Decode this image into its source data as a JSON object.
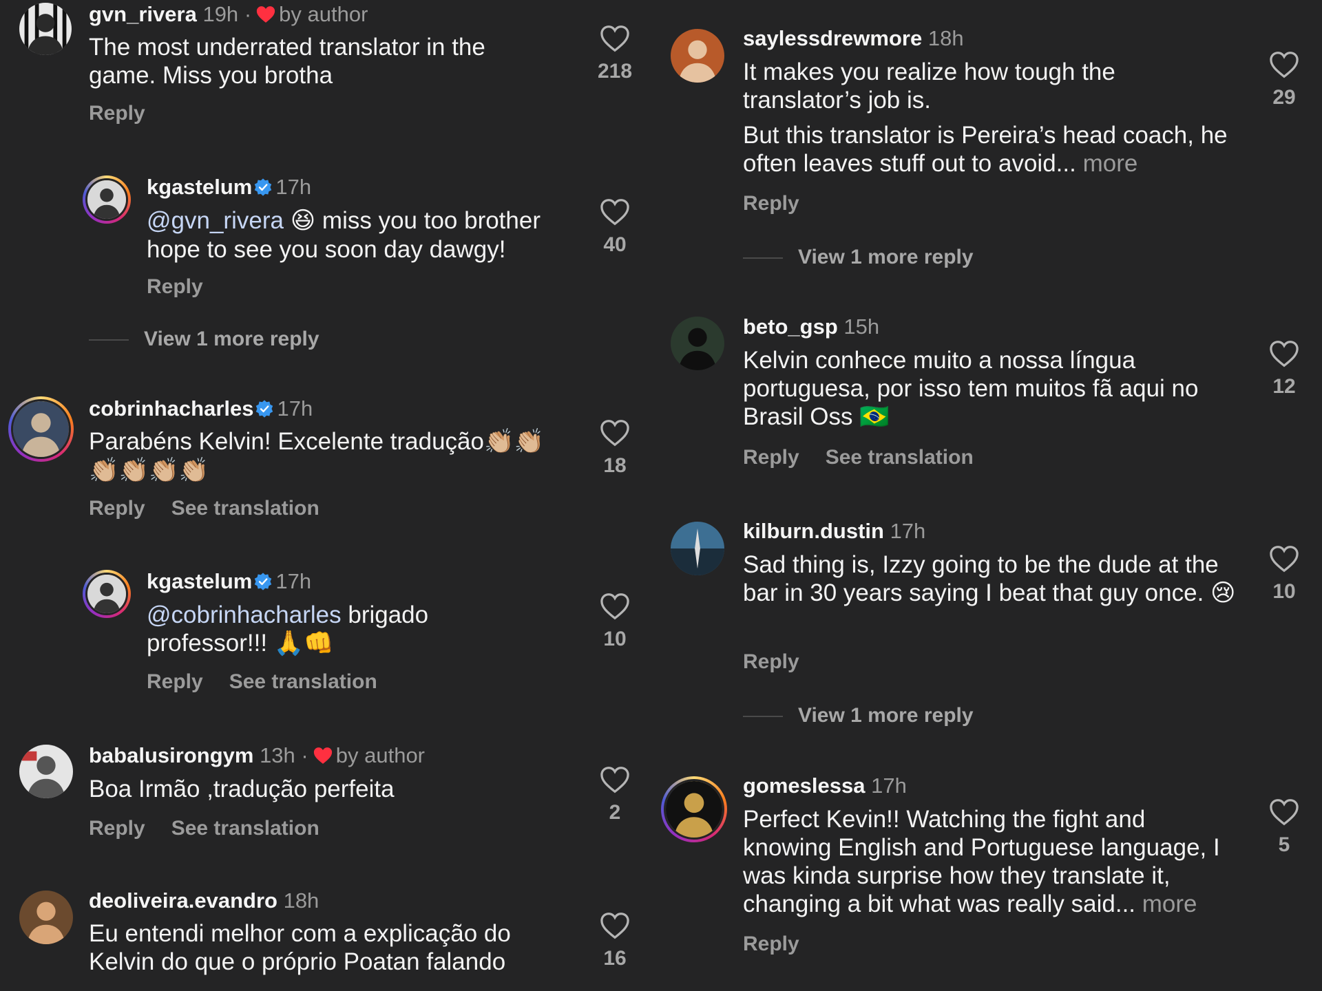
{
  "labels": {
    "reply": "Reply",
    "see_translation": "See translation",
    "view_more_reply": "View 1 more reply",
    "by_author": "by author",
    "sep": "·",
    "more": "more"
  },
  "left": [
    {
      "user": "gvn_rivera",
      "time": "19h",
      "text": "The most underrated translator in the game. Miss you brotha",
      "likes": "218"
    },
    {
      "user": "kgastelum",
      "time": "17h",
      "mention": "@gvn_rivera",
      "emoji": "😆",
      "text": " miss you too brother hope to see you soon day dawgy!",
      "likes": "40"
    },
    {
      "user": "cobrinhacharles",
      "time": "17h",
      "text": "Parabéns Kelvin! Excelente tradução",
      "emoji": "👏🏼👏🏼 👏🏼👏🏼👏🏼👏🏼",
      "likes": "18"
    },
    {
      "user": "kgastelum",
      "time": "17h",
      "mention": "@cobrinhacharles",
      "text": " brigado professor!!!",
      "emoji": "🙏👊",
      "likes": "10"
    },
    {
      "user": "babalusirongym",
      "time": "13h",
      "text": "Boa Irmão ,tradução perfeita",
      "likes": "2"
    },
    {
      "user": "deoliveira.evandro",
      "time": "18h",
      "text": "Eu entendi melhor com a explicação do Kelvin do que o próprio Poatan falando",
      "likes": "16"
    }
  ],
  "right": [
    {
      "user": "saylessdrewmore",
      "time": "18h",
      "text": "It makes you realize how tough the translator’s job is.",
      "text2": "But this translator is Pereira’s head coach, he often leaves stuff out to avoid...",
      "likes": "29"
    },
    {
      "user": "beto_gsp",
      "time": "15h",
      "text": "Kelvin conhece muito a nossa língua portuguesa, por isso tem muitos fã aqui no Brasil Oss",
      "emoji": "🇧🇷",
      "likes": "12"
    },
    {
      "user": "kilburn.dustin",
      "time": "17h",
      "text": "Sad thing is, Izzy going to be the dude at the bar in 30 years saying I beat that guy once.",
      "emoji": "😢",
      "likes": "10"
    },
    {
      "user": "gomeslessa",
      "time": "17h",
      "text": "Perfect Kevin!! Watching the fight and knowing English and Portuguese language, I was kinda surprise how they translate it, changing a bit what was really said...",
      "likes": "5"
    }
  ],
  "colors": {
    "background": "#242425",
    "muted": "#9b9b9b",
    "verified": "#3897f0",
    "heart_red": "#ff3040"
  }
}
